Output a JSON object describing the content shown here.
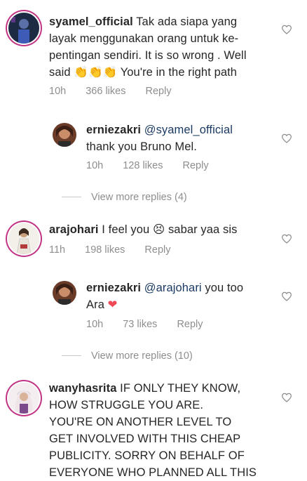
{
  "comments": [
    {
      "username": "syamel_official",
      "text": "Tak ada siapa yang layak menggunakan orang untuk ke-pentingan sendiri. It is so wrong . Well said 👏👏👏 You're in the right path",
      "line1": "Tak ada siapa yang",
      "line2": "layak menggunakan orang untuk ke-",
      "line3": "pentingan sendiri. It is so wrong . Well",
      "line4_pre": "said",
      "line4_emoji": "👏👏👏",
      "line4_post": "You're in the right path",
      "time": "10h",
      "likes": "366 likes",
      "reply": "Reply"
    },
    {
      "username": "erniezakri",
      "mention": "@syamel_official",
      "text": "thank you Bruno Mel.",
      "time": "10h",
      "likes": "128 likes",
      "reply": "Reply"
    },
    {
      "view_more": "View more replies (4)"
    },
    {
      "username": "arajohari",
      "text_pre": "I feel you",
      "emoji": "😣",
      "text_post": "sabar yaa sis",
      "time": "11h",
      "likes": "198 likes",
      "reply": "Reply"
    },
    {
      "username": "erniezakri",
      "mention": "@arajohari",
      "text_post": "you too",
      "line2": "Ara",
      "emoji": "❤",
      "time": "10h",
      "likes": "73 likes",
      "reply": "Reply"
    },
    {
      "view_more": "View more replies (10)"
    },
    {
      "username": "wanyhasrita",
      "line1": "IF ONLY THEY KNOW,",
      "line2": "HOW STRUGGLE YOU ARE.",
      "line3": "YOU'RE ON ANOTHER LEVEL TO",
      "line4": "GET INVOLVED WITH THIS CHEAP",
      "line5": "PUBLICITY. SORRY ON BEHALF OF",
      "line6": "EVERYONE WHO PLANNED ALL THIS"
    }
  ],
  "icons": {
    "like": "heart-outline-icon"
  },
  "colors": {
    "text": "#262626",
    "meta": "#8e8e8e",
    "mention": "#1b3a63",
    "story_ring": "#c13584",
    "red_heart": "#ed4956"
  }
}
